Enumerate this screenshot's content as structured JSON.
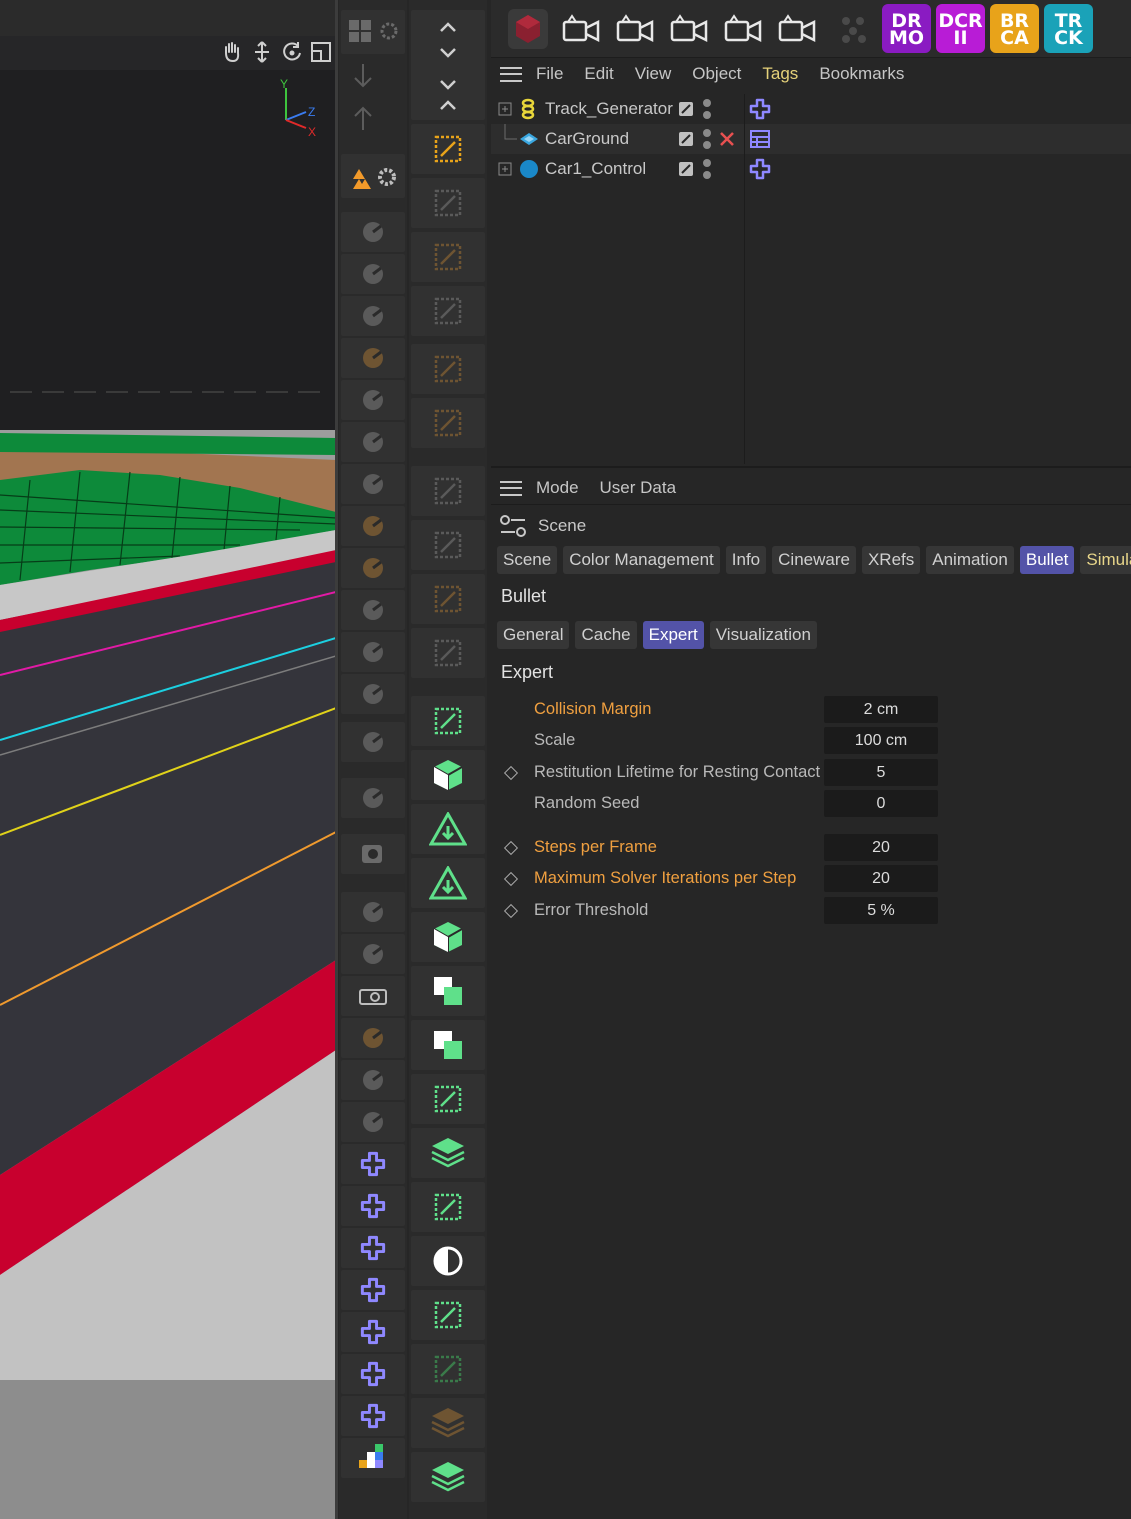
{
  "colors": {
    "accent_tab": "#5353a8",
    "highlight_param": "#f0a040",
    "active_menu": "#e6d27a",
    "road_red": "#c8002e",
    "grass_green": "#0d8a3a",
    "python_icon": "#8f88ff",
    "palette_green": "#5fe08a"
  },
  "viewport": {
    "axes": {
      "y": "Y",
      "z": "Z",
      "x": "X"
    },
    "nav_icons": [
      "hand-icon",
      "move-icon",
      "rotate-icon",
      "maximize-icon"
    ]
  },
  "top_toolbar": {
    "icons": [
      "cube-logo-icon",
      "camera-icon",
      "camera-icon",
      "camera-icon",
      "camera-icon",
      "camera-icon",
      "dots-icon"
    ],
    "badges": [
      {
        "line1": "DR",
        "line2": "MO",
        "color": "#8a1bc2"
      },
      {
        "line1": "DCR",
        "line2": "II",
        "color": "#b81cd6"
      },
      {
        "line1": "BR",
        "line2": "CA",
        "color": "#e8a31a"
      },
      {
        "line1": "TR",
        "line2": "CK",
        "color": "#1aa2b8"
      }
    ]
  },
  "object_manager": {
    "menu": [
      "File",
      "Edit",
      "View",
      "Object",
      "Tags",
      "Bookmarks"
    ],
    "active_menu": "Tags",
    "objects": [
      {
        "name": "Track_Generator",
        "icon": "generator-icon",
        "tag": "python-tag-icon"
      },
      {
        "name": "CarGround",
        "icon": "plane-icon",
        "tag": "rigid-body-tag-icon"
      },
      {
        "name": "Car1_Control",
        "icon": "null-sphere-icon",
        "tag": "python-tag-icon"
      }
    ]
  },
  "attribute_manager": {
    "menu": [
      "Mode",
      "User Data"
    ],
    "object_title": "Scene",
    "tabs": [
      "Scene",
      "Color Management",
      "Info",
      "Cineware",
      "XRefs",
      "Animation",
      "Bullet",
      "Simulati"
    ],
    "active_tab": "Bullet",
    "section": "Bullet",
    "subtabs": [
      "General",
      "Cache",
      "Expert",
      "Visualization"
    ],
    "active_subtab": "Expert",
    "subsection": "Expert",
    "params": [
      {
        "label": "Collision Margin",
        "value": "2 cm",
        "highlight": true,
        "keyframe": false
      },
      {
        "label": "Scale",
        "value": "100 cm",
        "highlight": false,
        "keyframe": false
      },
      {
        "label": "Restitution Lifetime for Resting Contact",
        "value": "5",
        "highlight": false,
        "keyframe": true
      },
      {
        "label": "Random Seed",
        "value": "0",
        "highlight": false,
        "keyframe": false
      },
      {
        "label": "Steps per Frame",
        "value": "20",
        "highlight": true,
        "keyframe": true
      },
      {
        "label": "Maximum Solver Iterations per Step",
        "value": "20",
        "highlight": true,
        "keyframe": true
      },
      {
        "label": "Error Threshold",
        "value": "5 %",
        "highlight": false,
        "keyframe": true
      }
    ]
  }
}
